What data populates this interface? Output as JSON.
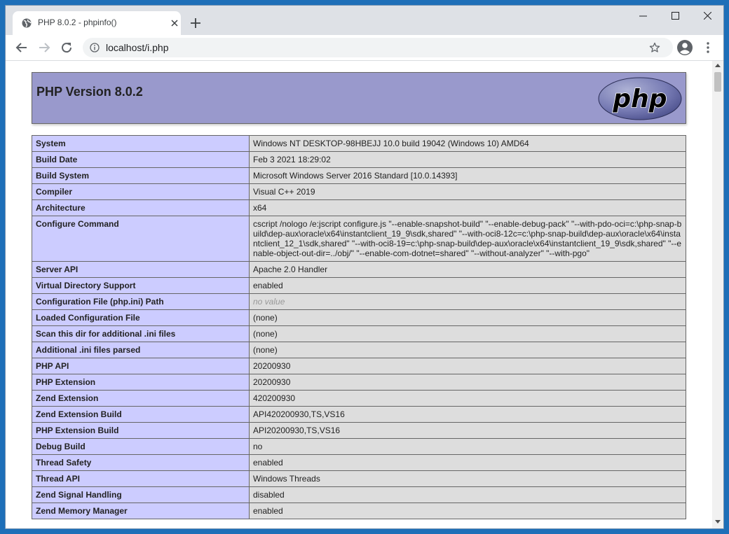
{
  "tab": {
    "title": "PHP 8.0.2 - phpinfo()"
  },
  "address_bar": {
    "url": "localhost/i.php"
  },
  "page": {
    "header_title": "PHP Version 8.0.2",
    "logo_text": "php",
    "rows": [
      {
        "key": "System",
        "value": "Windows NT DESKTOP-98HBEJJ 10.0 build 19042 (Windows 10) AMD64"
      },
      {
        "key": "Build Date",
        "value": "Feb 3 2021 18:29:02"
      },
      {
        "key": "Build System",
        "value": "Microsoft Windows Server 2016 Standard [10.0.14393]"
      },
      {
        "key": "Compiler",
        "value": "Visual C++ 2019"
      },
      {
        "key": "Architecture",
        "value": "x64"
      },
      {
        "key": "Configure Command",
        "value": "cscript /nologo /e:jscript configure.js \"--enable-snapshot-build\" \"--enable-debug-pack\" \"--with-pdo-oci=c:\\php-snap-build\\dep-aux\\oracle\\x64\\instantclient_19_9\\sdk,shared\" \"--with-oci8-12c=c:\\php-snap-build\\dep-aux\\oracle\\x64\\instantclient_12_1\\sdk,shared\" \"--with-oci8-19=c:\\php-snap-build\\dep-aux\\oracle\\x64\\instantclient_19_9\\sdk,shared\" \"--enable-object-out-dir=../obj/\" \"--enable-com-dotnet=shared\" \"--without-analyzer\" \"--with-pgo\""
      },
      {
        "key": "Server API",
        "value": "Apache 2.0 Handler"
      },
      {
        "key": "Virtual Directory Support",
        "value": "enabled"
      },
      {
        "key": "Configuration File (php.ini) Path",
        "value": "no value"
      },
      {
        "key": "Loaded Configuration File",
        "value": "(none)"
      },
      {
        "key": "Scan this dir for additional .ini files",
        "value": "(none)"
      },
      {
        "key": "Additional .ini files parsed",
        "value": "(none)"
      },
      {
        "key": "PHP API",
        "value": "20200930"
      },
      {
        "key": "PHP Extension",
        "value": "20200930"
      },
      {
        "key": "Zend Extension",
        "value": "420200930"
      },
      {
        "key": "Zend Extension Build",
        "value": "API420200930,TS,VS16"
      },
      {
        "key": "PHP Extension Build",
        "value": "API20200930,TS,VS16"
      },
      {
        "key": "Debug Build",
        "value": "no"
      },
      {
        "key": "Thread Safety",
        "value": "enabled"
      },
      {
        "key": "Thread API",
        "value": "Windows Threads"
      },
      {
        "key": "Zend Signal Handling",
        "value": "disabled"
      },
      {
        "key": "Zend Memory Manager",
        "value": "enabled"
      }
    ]
  },
  "colors": {
    "header_bg": "#9999cc",
    "key_bg": "#ccccff",
    "value_bg": "#dddddd",
    "desktop_bg": "#1e6fb8"
  },
  "icons": {
    "favicon": "globe-icon",
    "back": "arrow-left-icon",
    "forward": "arrow-right-icon",
    "reload": "reload-icon",
    "info": "info-icon",
    "bookmark": "star-icon",
    "profile": "profile-icon",
    "menu": "kebab-menu-icon"
  }
}
